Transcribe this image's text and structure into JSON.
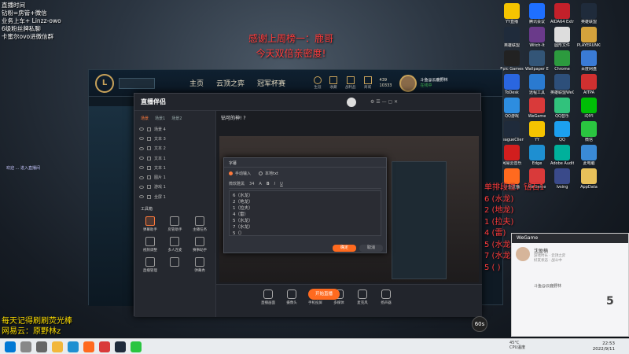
{
  "stream_info": [
    "直播时间",
    "钻粉=房管+微信",
    "业务上车+ Linzz-owo",
    "6级粉丝牌私聊",
    "卡蜜尔ovo进微信群"
  ],
  "banner": {
    "line1": "感谢上周榜一：鹿哥",
    "line2": "今天双倍亲密度!"
  },
  "footer_overlay": {
    "line1": "每天记得刷刷荧光棒",
    "line2": "网易云：原野林z"
  },
  "rank_overlay": {
    "title": "单排段位：钻石1",
    "lines": [
      "6 (水龙)",
      "2 (地龙)",
      "1 (拉夫)",
      "4 (雷)",
      "5 (水龙)",
      "7 (水龙)",
      "5 ( )"
    ]
  },
  "lol": {
    "nav": [
      "主页",
      "云顶之弈",
      "冠军杯赛"
    ],
    "icons": [
      "生涯",
      "收藏",
      "战利品",
      "商城"
    ],
    "currency_be": "439",
    "currency_rp": "10333",
    "player": "斗鱼@云鹿野林",
    "status": "在线中"
  },
  "stream_app": {
    "logo": "直播伴侣",
    "title": "钻可的神! ?",
    "tabs": [
      "场景",
      "场景1",
      "场景2"
    ],
    "scenes": [
      "场景 4",
      "文本 3",
      "文本 2",
      "文本 1",
      "文本 1",
      "图片 1",
      "游戏 1",
      "全屏 1"
    ],
    "tools_title": "工具箱",
    "tools": [
      "弹幕助手",
      "房管助手",
      "主播任务",
      "视频调整",
      "多人连麦",
      "赛事助手",
      "直播管理",
      "",
      "弹幕秀"
    ],
    "bottom_tools": [
      "直播画面",
      "摄像头",
      "手机投屏",
      "多媒体",
      "麦克风",
      "扬声器"
    ],
    "start_label": "开始直播"
  },
  "dialog": {
    "title": "字幕",
    "mode_manual": "手动输入",
    "mode_local": "本地txt",
    "toolbar": [
      "微软雅黑",
      "34",
      "A",
      "B",
      "I",
      "U"
    ],
    "lines": [
      "6（水龙）",
      "2（地龙）",
      "1（拉夫）",
      "4（雷）",
      "5（水龙）",
      "7（水龙）",
      "5（）"
    ],
    "ok": "确定",
    "cancel": "取消"
  },
  "chat_line": "欢迎 ... 进入直播间",
  "desktop_icons": [
    {
      "label": "YY直播",
      "color": "#f5c400"
    },
    {
      "label": "腾讯会议",
      "color": "#1e6fff"
    },
    {
      "label": "AIDA64 Extreme",
      "color": "#c3202a"
    },
    {
      "label": "英雄联盟",
      "color": "#1f2b3b"
    },
    {
      "label": "英雄联盟",
      "color": "#1f2b3b"
    },
    {
      "label": "Witch-It",
      "color": "#6a3a8a"
    },
    {
      "label": "圆形文件",
      "color": "#ddd"
    },
    {
      "label": "PLAYERUNKNOWN'S BATTLEGROUNDS",
      "color": "#d4a23c"
    },
    {
      "label": "Epic Games",
      "color": "#222"
    },
    {
      "label": "Wallpaper Engine",
      "color": "#335577"
    },
    {
      "label": "Chrome",
      "color": "#2c9a3e"
    },
    {
      "label": "百度网盘",
      "color": "#3a7bd5"
    },
    {
      "label": "ToDesk",
      "color": "#2a66e0"
    },
    {
      "label": "远程工具",
      "color": "#2a7ad0"
    },
    {
      "label": "英雄联盟WeGame版",
      "color": "#2d4f7a"
    },
    {
      "label": "AITPA",
      "color": "#d03030"
    },
    {
      "label": "QQ游戏",
      "color": "#2d8de0"
    },
    {
      "label": "WeGame",
      "color": "#d93a3a"
    },
    {
      "label": "QQ音乐",
      "color": "#31c27c"
    },
    {
      "label": "iQIYI",
      "color": "#00be06"
    },
    {
      "label": "LeagueClient",
      "color": "#1f2b3b"
    },
    {
      "label": "YY",
      "color": "#f5c400"
    },
    {
      "label": "QQ",
      "color": "#1ca0f0"
    },
    {
      "label": "微信",
      "color": "#2ac540"
    },
    {
      "label": "网易云音乐",
      "color": "#d21e1e"
    },
    {
      "label": "Edge",
      "color": "#1e8fd1"
    },
    {
      "label": "Adobe Audition",
      "color": "#00b09b"
    },
    {
      "label": "此电脑",
      "color": "#3a8ad6"
    },
    {
      "label": "斗鱼直播",
      "color": "#ff6a1f"
    },
    {
      "label": "WeGame",
      "color": "#d93a3a"
    },
    {
      "label": "Ivsing",
      "color": "#3a4a8a"
    },
    {
      "label": "AppData",
      "color": "#e8c15a"
    }
  ],
  "wegame": {
    "title": "WeGame",
    "name": "沈盈楠",
    "sub1": "游戏时长 · 云顶之弈",
    "sub2": "好友状态 · 战斗中",
    "card_title": "斗鱼@云鹿野林",
    "rank_number": "5"
  },
  "fps_badge": "60s",
  "taskbar": {
    "time": "22:53",
    "date": "2022/9/11",
    "weather_temp": "45°C",
    "weather_desc": "CPU温度"
  }
}
